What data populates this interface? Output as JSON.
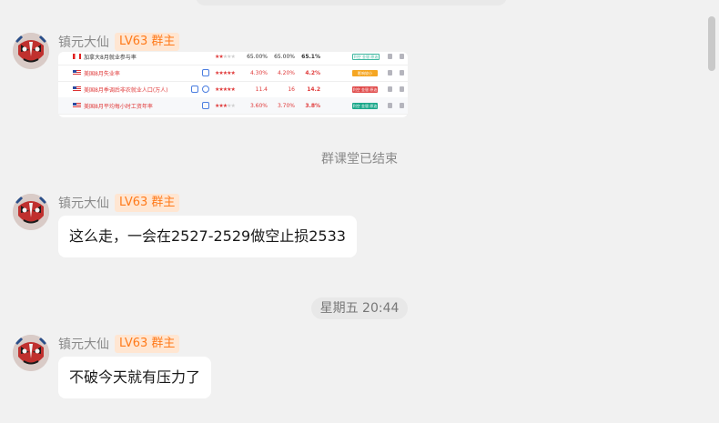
{
  "colors": {
    "background": "#f1f1f1",
    "bubble": "#ffffff",
    "badge_text": "#ff7a1a",
    "badge_bg": "#ffe6d2"
  },
  "messages": [
    {
      "sender": "镇元大仙",
      "badge": "LV63 群主",
      "type": "image",
      "image": {
        "rows": [
          {
            "name": "加拿大8月就业参与率",
            "stars_on": 2,
            "values": [
              "65.00%",
              "65.00%",
              "65.1%"
            ],
            "tag": "利空 金银 原油"
          },
          {
            "name": "美国8月失业率",
            "stars_on": 5,
            "values": [
              "4.30%",
              "4.20%",
              "4.2%"
            ],
            "tag": "影响较小"
          },
          {
            "name": "美国8月季调后非农就业人口(万人)",
            "stars_on": 5,
            "values": [
              "11.4",
              "16",
              "14.2"
            ],
            "tag": "利空 金银 原油"
          },
          {
            "name": "美国8月平均每小时工资年率",
            "stars_on": 3,
            "values": [
              "3.60%",
              "3.70%",
              "3.8%"
            ],
            "tag": "利空 金银 原油"
          }
        ]
      }
    },
    {
      "type": "system",
      "text": "群课堂已结束"
    },
    {
      "sender": "镇元大仙",
      "badge": "LV63 群主",
      "type": "text",
      "text": "这么走，一会在2527-2529做空止损2533"
    },
    {
      "type": "time",
      "text": "星期五 20:44"
    },
    {
      "sender": "镇元大仙",
      "badge": "LV63 群主",
      "type": "text",
      "text": "不破今天就有压力了"
    }
  ]
}
